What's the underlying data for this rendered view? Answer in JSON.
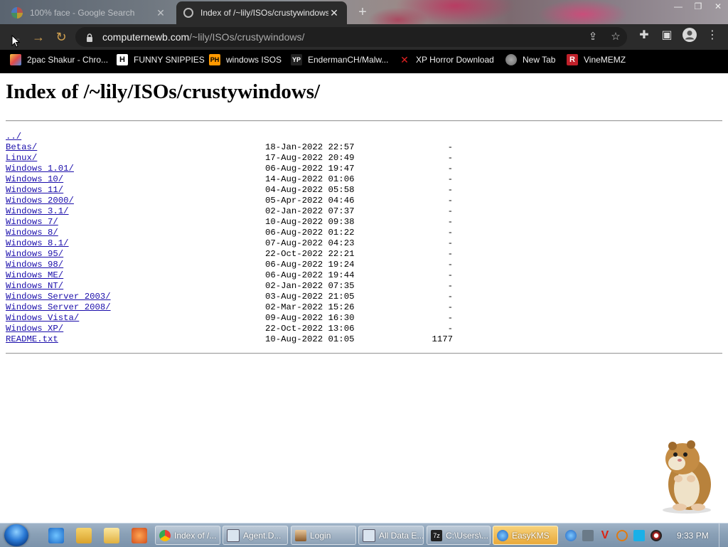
{
  "browser": {
    "tabs": [
      {
        "title": "100% face - Google Search",
        "active": false
      },
      {
        "title": "Index of /~lily/ISOs/crustywindows/",
        "active": true
      }
    ],
    "address": {
      "host": "computernewb.com",
      "path": "/~lily/ISOs/crustywindows/"
    },
    "bookmarks": [
      {
        "label": "2pac Shakur - Chro...",
        "icon": "paint-icon"
      },
      {
        "label": "FUNNY SNIPPIES",
        "icon": "h-icon"
      },
      {
        "label": "windows ISOS",
        "icon": "ph-icon"
      },
      {
        "label": "EndermanCH/Malw...",
        "icon": "yp-icon"
      },
      {
        "label": "XP Horror Download",
        "icon": "x-icon"
      },
      {
        "label": "New Tab",
        "icon": "globe-icon"
      },
      {
        "label": "VineMEMZ",
        "icon": "r-icon"
      }
    ]
  },
  "page": {
    "heading": "Index of /~lily/ISOs/crustywindows/",
    "parent": "../",
    "entries": [
      {
        "name": "Betas/",
        "date": "18-Jan-2022 22:57",
        "size": "-"
      },
      {
        "name": "Linux/",
        "date": "17-Aug-2022 20:49",
        "size": "-"
      },
      {
        "name": "Windows 1.01/",
        "date": "06-Aug-2022 19:47",
        "size": "-"
      },
      {
        "name": "Windows 10/",
        "date": "14-Aug-2022 01:06",
        "size": "-"
      },
      {
        "name": "Windows 11/",
        "date": "04-Aug-2022 05:58",
        "size": "-"
      },
      {
        "name": "Windows 2000/",
        "date": "05-Apr-2022 04:46",
        "size": "-"
      },
      {
        "name": "Windows 3.1/",
        "date": "02-Jan-2022 07:37",
        "size": "-"
      },
      {
        "name": "Windows 7/",
        "date": "10-Aug-2022 09:38",
        "size": "-"
      },
      {
        "name": "Windows 8/",
        "date": "06-Aug-2022 01:22",
        "size": "-"
      },
      {
        "name": "Windows 8.1/",
        "date": "07-Aug-2022 04:23",
        "size": "-"
      },
      {
        "name": "Windows 95/",
        "date": "22-Oct-2022 22:21",
        "size": "-"
      },
      {
        "name": "Windows 98/",
        "date": "06-Aug-2022 19:24",
        "size": "-"
      },
      {
        "name": "Windows ME/",
        "date": "06-Aug-2022 19:44",
        "size": "-"
      },
      {
        "name": "Windows NT/",
        "date": "02-Jan-2022 07:35",
        "size": "-"
      },
      {
        "name": "Windows Server 2003/",
        "date": "03-Aug-2022 21:05",
        "size": "-"
      },
      {
        "name": "Windows Server 2008/",
        "date": "02-Mar-2022 15:26",
        "size": "-"
      },
      {
        "name": "Windows Vista/",
        "date": "09-Aug-2022 16:30",
        "size": "-"
      },
      {
        "name": "Windows XP/",
        "date": "22-Oct-2022 13:06",
        "size": "-"
      },
      {
        "name": "README.txt",
        "date": "10-Aug-2022 01:05",
        "size": "1177"
      }
    ]
  },
  "taskbar": {
    "tasks": [
      {
        "label": "Index of /...",
        "icon": "chrome-icon",
        "active": false
      },
      {
        "label": "Agent.D...",
        "icon": "window-icon",
        "active": false
      },
      {
        "label": "Login",
        "icon": "user-icon",
        "active": false
      },
      {
        "label": "All Data E...",
        "icon": "window-icon",
        "active": false
      },
      {
        "label": "C:\\Users\\...",
        "icon": "7zip-icon",
        "active": false
      },
      {
        "label": "EasyKMS",
        "icon": "kms-icon",
        "active": true
      }
    ],
    "clock": "9:33 PM"
  },
  "colors": {
    "link": "#1a0dab",
    "chrome_toolbar": "#2b2b2b",
    "bookmark_bar": "#000000",
    "taskbar": "#8aa0b6",
    "active_task": "#e9a93a"
  }
}
